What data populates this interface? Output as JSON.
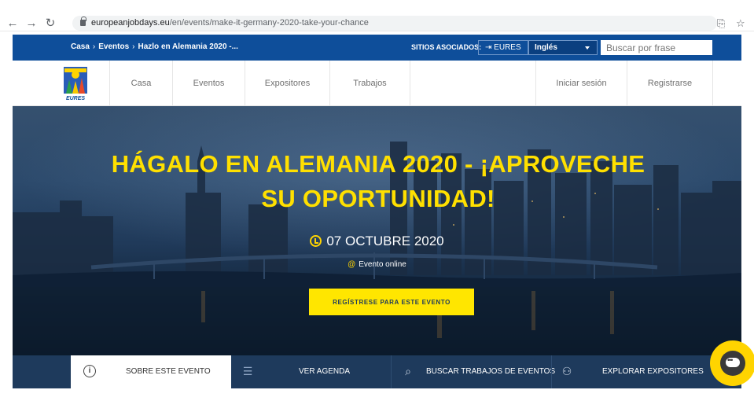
{
  "browser": {
    "url_domain": "europeanjobdays.eu",
    "url_path": "/en/events/make-it-germany-2020-take-your-chance"
  },
  "topbar": {
    "breadcrumb": [
      "Casa",
      "Eventos",
      "Hazlo en Alemania 2020 -..."
    ],
    "associated_label": "SITIOS ASOCIADOS:",
    "eures_label": "EURES",
    "language": "Inglés",
    "search_placeholder": "Buscar por frase"
  },
  "mainnav": {
    "items": [
      "Casa",
      "Eventos",
      "Expositores",
      "Trabajos"
    ],
    "login": "Iniciar sesión",
    "register": "Registrarse",
    "logo_text": "EURES"
  },
  "hero": {
    "title_line1": "HÁGALO EN ALEMANIA 2020 - ¡APROVECHE",
    "title_line2": "SU OPORTUNIDAD!",
    "date": "07 OCTUBRE 2020",
    "location": "Evento online",
    "cta": "REGÍSTRESE PARA ESTE EVENTO"
  },
  "tabs": [
    {
      "label": "SOBRE ESTE EVENTO",
      "icon": "info-icon"
    },
    {
      "label": "VER AGENDA",
      "icon": "list-icon"
    },
    {
      "label": "BUSCAR TRABAJOS DE EVENTOS",
      "icon": "search-jobs-icon"
    },
    {
      "label": "EXPLORAR EXPOSITORES",
      "icon": "users-icon"
    }
  ],
  "colors": {
    "brand_blue": "#0e4e9a",
    "accent_yellow": "#ffe000",
    "tabs_bg": "#1e3a5c"
  }
}
